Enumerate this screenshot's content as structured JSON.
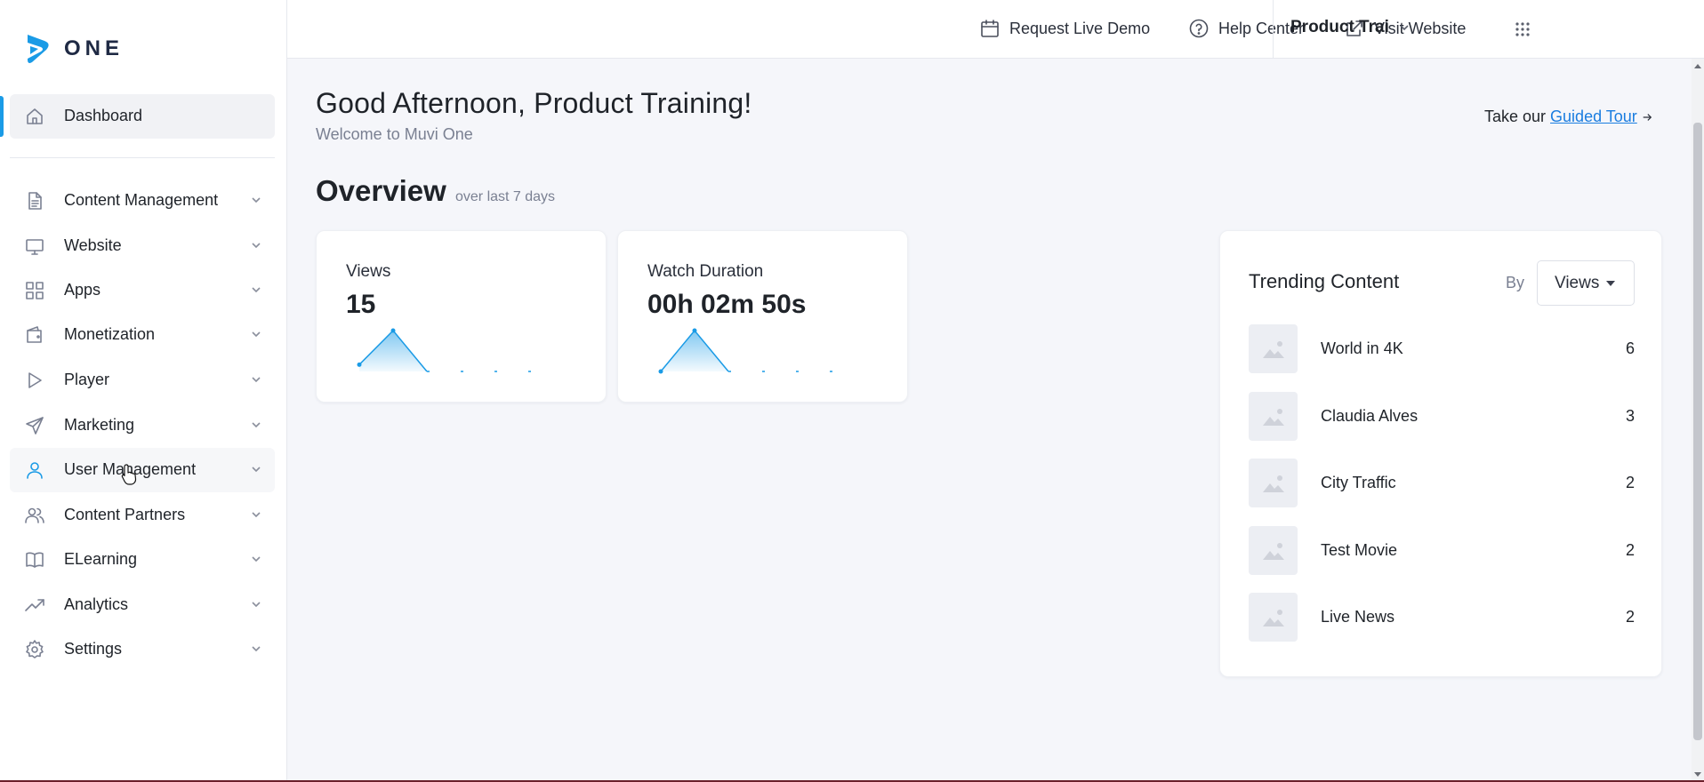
{
  "brand": {
    "logo_text": "ONE",
    "accent": "#1a9be6"
  },
  "topbar": {
    "request_demo": "Request Live Demo",
    "help_center": "Help Center",
    "visit_website": "Visit Website",
    "user_name": "Product Trai"
  },
  "sidebar": {
    "items": [
      {
        "label": "Dashboard",
        "icon": "home-icon",
        "active": true
      },
      {
        "label": "Content Management",
        "icon": "document-icon"
      },
      {
        "label": "Website",
        "icon": "monitor-icon"
      },
      {
        "label": "Apps",
        "icon": "apps-grid-icon"
      },
      {
        "label": "Monetization",
        "icon": "wallet-icon"
      },
      {
        "label": "Player",
        "icon": "play-icon"
      },
      {
        "label": "Marketing",
        "icon": "send-icon"
      },
      {
        "label": "User Management",
        "icon": "user-icon"
      },
      {
        "label": "Content Partners",
        "icon": "users-icon"
      },
      {
        "label": "ELearning",
        "icon": "book-icon"
      },
      {
        "label": "Analytics",
        "icon": "trending-up-icon"
      },
      {
        "label": "Settings",
        "icon": "gear-icon"
      }
    ]
  },
  "main": {
    "greeting": "Good Afternoon, Product Training!",
    "welcome": "Welcome to Muvi One",
    "tour_prefix": "Take our ",
    "tour_link": "Guided Tour",
    "overview_title": "Overview",
    "overview_sub": "over last 7 days"
  },
  "stats": [
    {
      "title": "Views",
      "value": "15",
      "trend": [
        1,
        6,
        0,
        0,
        0,
        0,
        0
      ]
    },
    {
      "title": "Watch Duration",
      "value": "00h 02m 50s",
      "trend": [
        0,
        6,
        0,
        0,
        0,
        0,
        0
      ]
    }
  ],
  "trending": {
    "title": "Trending Content",
    "by_label": "By",
    "sort_value": "Views",
    "items": [
      {
        "name": "World in 4K",
        "count": "6"
      },
      {
        "name": "Claudia Alves",
        "count": "3"
      },
      {
        "name": "City Traffic",
        "count": "2"
      },
      {
        "name": "Test Movie",
        "count": "2"
      },
      {
        "name": "Live News",
        "count": "2"
      }
    ]
  }
}
